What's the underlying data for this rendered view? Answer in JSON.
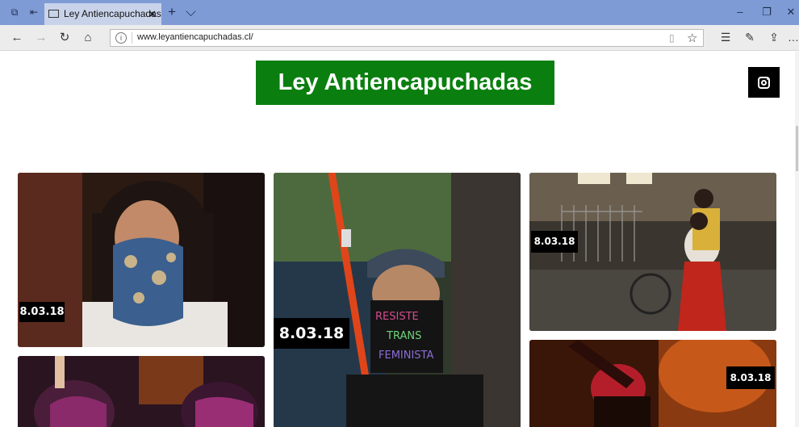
{
  "browser": {
    "tab_title": "Ley Antiencapuchadas /",
    "tab_close": "✕",
    "new_tab": "+",
    "tab_menu": "⌵",
    "url": "www.leyantiencapuchadas.cl/",
    "window_controls": {
      "minimize": "–",
      "restore": "❐",
      "close": "✕"
    },
    "icons": [
      "tab-preview-icon",
      "set-aside-icon",
      "back-icon",
      "forward-icon",
      "refresh-icon",
      "home-icon",
      "site-info-icon",
      "reading-view-icon",
      "favorite-star-icon",
      "favorites-hub-icon",
      "pen-icon",
      "share-icon",
      "more-icon"
    ]
  },
  "site": {
    "logo_text": "Ley Antiencapuchadas",
    "logo_color": "#0a7f0f",
    "social_icon": "instagram-icon"
  },
  "gallery": {
    "cards": [
      {
        "date": "8.03.18",
        "image": "girl-blue-bandana"
      },
      {
        "date": "8.03.18",
        "image": "person-resiste-trans-feminista-mask"
      },
      {
        "date": "8.03.18",
        "image": "woman-carrying-child-street"
      },
      {
        "image": "masked-protesters-purple"
      },
      {
        "date": "8.03.18",
        "image": "protester-red-flare"
      }
    ]
  }
}
